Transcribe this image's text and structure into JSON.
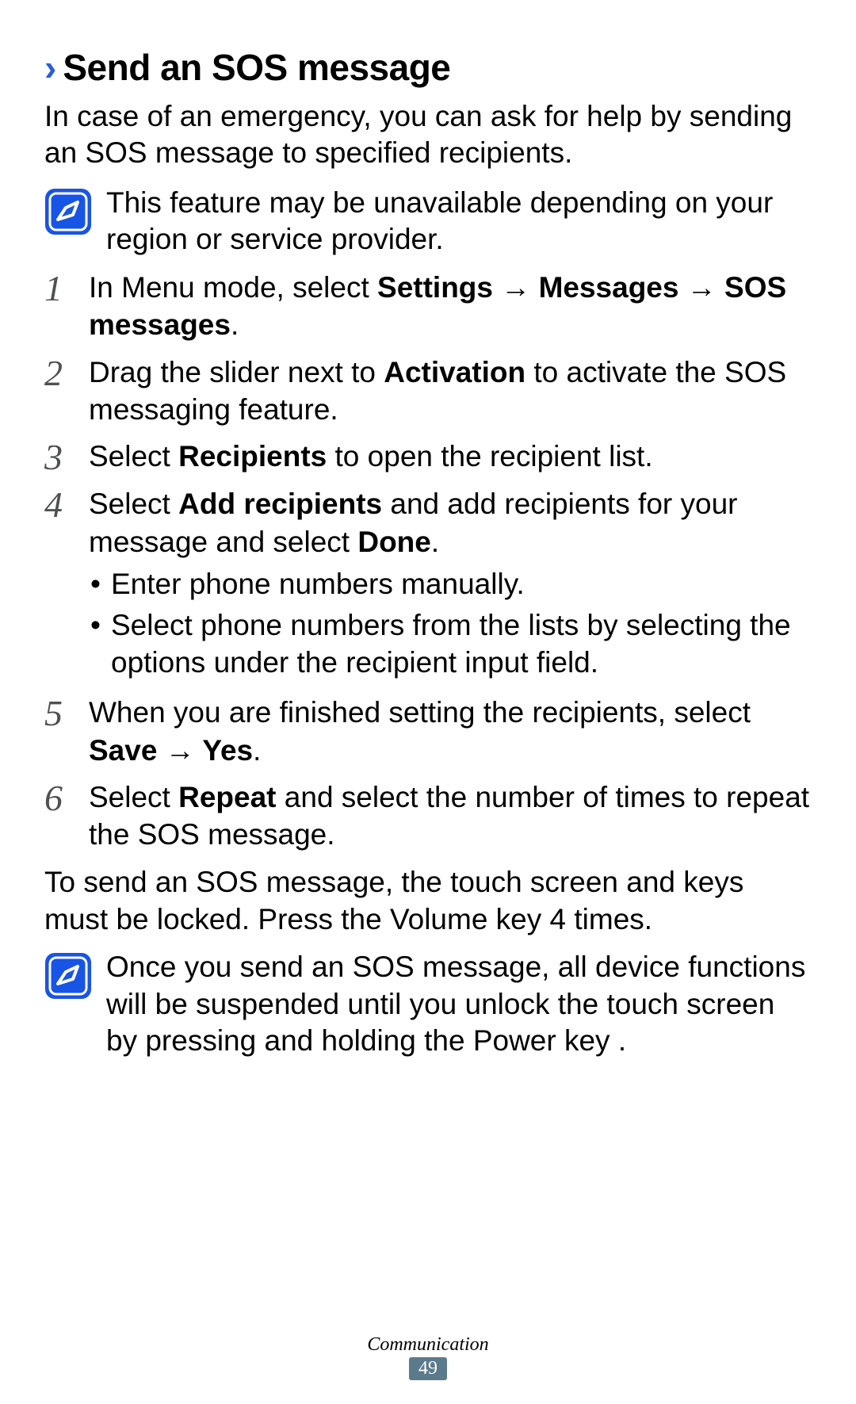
{
  "heading": {
    "chevron": "›",
    "title": "Send an SOS message"
  },
  "intro": "In case of an emergency, you can ask for help by sending an SOS message to specified recipients.",
  "note1": "This feature may be unavailable depending on your region or service provider.",
  "steps": {
    "s1": {
      "num": "1",
      "prefix": "In Menu mode, select ",
      "b1": "Settings",
      "arrow1": " → ",
      "b2": "Messages",
      "arrow2": " → ",
      "b3": "SOS messages",
      "suffix": "."
    },
    "s2": {
      "num": "2",
      "t1": "Drag the slider next to ",
      "b1": "Activation",
      "t2": " to activate the SOS messaging feature."
    },
    "s3": {
      "num": "3",
      "t1": "Select ",
      "b1": "Recipients",
      "t2": " to open the recipient list."
    },
    "s4": {
      "num": "4",
      "t1": "Select ",
      "b1": "Add recipients",
      "t2": " and add recipients for your message and select ",
      "b2": "Done",
      "t3": ".",
      "sub1": "Enter phone numbers manually.",
      "sub2": "Select phone numbers from the lists by selecting the options under the recipient input field."
    },
    "s5": {
      "num": "5",
      "t1": "When you are finished setting the recipients, select ",
      "b1": "Save",
      "arrow": " → ",
      "b2": "Yes",
      "t2": "."
    },
    "s6": {
      "num": "6",
      "t1": "Select ",
      "b1": "Repeat",
      "t2": " and select the number of times to repeat the SOS message."
    }
  },
  "para": "To send an SOS message, the touch screen and keys must be locked. Press the Volume key 4 times.",
  "note2": "Once you send an SOS message, all device functions will be suspended until you unlock the touch screen by pressing and holding the Power key .",
  "footer": {
    "section": "Communication",
    "page": "49"
  }
}
